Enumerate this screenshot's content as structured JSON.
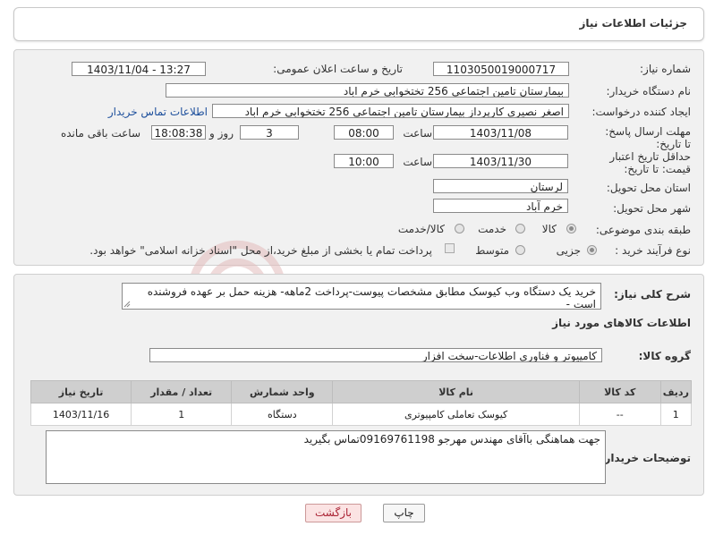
{
  "header": {
    "title": "جزئیات اطلاعات نیاز"
  },
  "form": {
    "need_number": {
      "label": "شماره نیاز:",
      "value": "1103050019000717"
    },
    "announce_datetime": {
      "label": "تاریخ و ساعت اعلان عمومی:",
      "value": "1403/11/04 - 13:27"
    },
    "buyer_org": {
      "label": "نام دستگاه خریدار:",
      "value": "بیمارستان تامین اجتماعی  256 تختخوابی خرم اباد"
    },
    "requester": {
      "label": "ایجاد کننده درخواست:",
      "value": "اصغر نصیری کارپرداز بیمارستان تامین اجتماعی  256 تختخوابی خرم اباد",
      "contact_link": "اطلاعات تماس خریدار"
    },
    "reply_deadline": {
      "label": "مهلت ارسال پاسخ: تا تاریخ:",
      "date": "1403/11/08",
      "time_label": "ساعت",
      "time": "08:00",
      "days": "3",
      "days_label": "روز و",
      "remaining": "18:08:38",
      "remaining_label": "ساعت باقی مانده"
    },
    "min_validity": {
      "label": "حداقل تاریخ اعتبار قیمت: تا تاریخ:",
      "date": "1403/11/30",
      "time_label": "ساعت",
      "time": "10:00"
    },
    "province": {
      "label": "استان محل تحویل:",
      "value": "لرستان"
    },
    "city": {
      "label": "شهر محل تحویل:",
      "value": "خرم آباد"
    },
    "category": {
      "label": "طبقه بندی موضوعی:",
      "options": [
        "کالا",
        "خدمت",
        "کالا/خدمت"
      ],
      "selected": "کالا"
    },
    "purchase_type": {
      "label": "نوع فرآیند خرید :",
      "options": [
        "جزیی",
        "متوسط"
      ],
      "selected": "جزیی",
      "treasury_note": "پرداخت تمام یا بخشی از مبلغ خرید،از محل \"اسناد خزانه اسلامی\" خواهد بود."
    }
  },
  "summary": {
    "label": "شرح کلی نیاز:",
    "value": "خرید یک دستگاه وب کیوسک مطابق مشخصات پیوست-پرداخت 2ماهه- هزینه حمل بر عهده فروشنده است -"
  },
  "goods": {
    "section_title": "اطلاعات کالاهای مورد نیاز",
    "group_label": "گروه کالا:",
    "group_value": "کامپیوتر و فناوری اطلاعات-سخت افزار",
    "table": {
      "headers": [
        "ردیف",
        "کد کالا",
        "نام کالا",
        "واحد شمارش",
        "تعداد / مقدار",
        "تاریخ نیاز"
      ],
      "rows": [
        [
          "1",
          "--",
          "کیوسک تعاملی کامپیوتری",
          "دستگاه",
          "1",
          "1403/11/16"
        ]
      ]
    }
  },
  "buyer_notes": {
    "label": "توضیحات خریدار:",
    "value": "جهت هماهنگی باآقای مهندس مهرجو 09169761198تماس بگیرید"
  },
  "buttons": {
    "print": "چاپ",
    "back": "بازگشت"
  },
  "colors": {
    "link": "#1d4f9c",
    "back_button_text": "#a23",
    "watermark": "#d9a3a3"
  },
  "watermark_icon": "ariatender-logo-icon"
}
